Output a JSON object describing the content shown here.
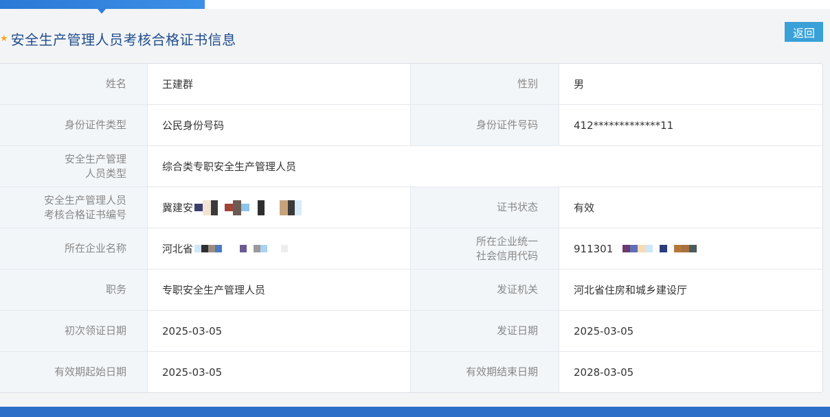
{
  "page_title": "安全生产管理人员考核合格证书信息",
  "back_label": "返回",
  "fields": {
    "name_label": "姓名",
    "name_value": "王建群",
    "gender_label": "性别",
    "gender_value": "男",
    "id_type_label": "身份证件类型",
    "id_type_value": "公民身份号码",
    "id_no_label": "身份证件号码",
    "id_no_value": "412*************11",
    "staff_type_label_1": "安全生产管理",
    "staff_type_label_2": "人员类型",
    "staff_type_value": "综合类专职安全生产管理人员",
    "cert_no_label_1": "安全生产管理人员",
    "cert_no_label_2": "考核合格证书编号",
    "cert_no_value": "冀建安",
    "cert_status_label": "证书状态",
    "cert_status_value": "有效",
    "company_label": "所在企业名称",
    "company_value": "河北省",
    "credit_code_label_1": "所在企业统一",
    "credit_code_label_2": "社会信用代码",
    "credit_code_value": "911301",
    "position_label": "职务",
    "position_value": "专职安全生产管理人员",
    "issuer_label": "发证机关",
    "issuer_value": "河北省住房和城乡建设厅",
    "first_issue_label": "初次领证日期",
    "first_issue_value": "2025-03-05",
    "issue_date_label": "发证日期",
    "issue_date_value": "2025-03-05",
    "valid_from_label": "有效期起始日期",
    "valid_from_value": "2025-03-05",
    "valid_to_label": "有效期结束日期",
    "valid_to_value": "2028-03-05"
  },
  "colors": {
    "accent": "#2b79d6",
    "title": "#1f4d8c",
    "back_button": "#3aa0d8",
    "star": "#f5a623"
  }
}
